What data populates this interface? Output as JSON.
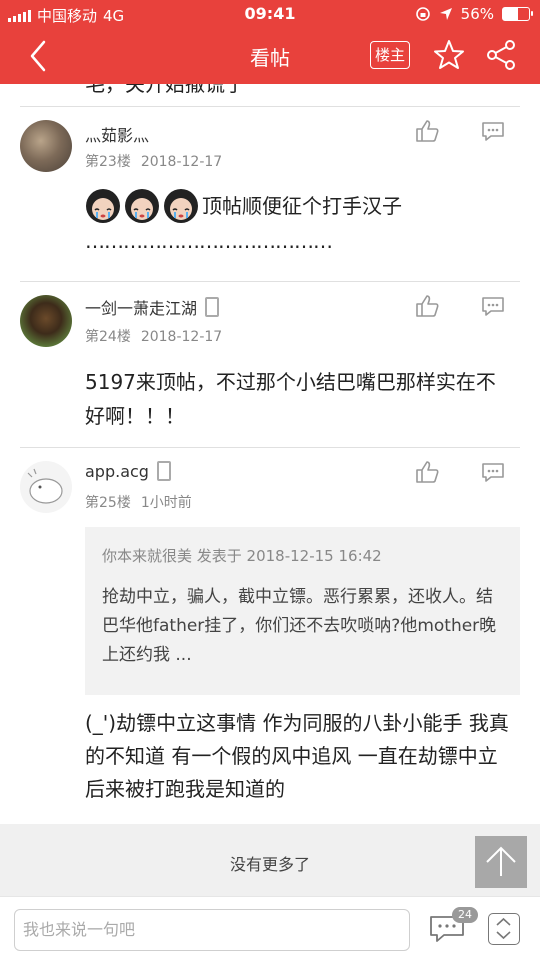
{
  "statusbar": {
    "carrier": "中国移动",
    "network": "4G",
    "time": "09:41",
    "battery": "56%"
  },
  "nav": {
    "title": "看帖",
    "louzhu": "楼主"
  },
  "feed": {
    "cut_text": "毛，关开始撒谎了",
    "posts": [
      {
        "user": "灬茹影灬",
        "floor": "第23楼",
        "time": "2018-12-17",
        "content_line1": "顶帖顺便征个打手汉子",
        "content_line2": "…………………………………"
      },
      {
        "user": "一剑一萧走江湖",
        "floor": "第24楼",
        "time": "2018-12-17",
        "content": "5197来顶帖，不过那个小结巴嘴巴那样实在不好啊！！！"
      },
      {
        "user": "app.acg",
        "floor": "第25楼",
        "time": "1小时前",
        "quote_head": "你本来就很美 发表于 2018-12-15 16:42",
        "quote_text": "抢劫中立，骗人，截中立镖。恶行累累，还收人。结巴华他father挂了，你们还不去吹唢呐?他mother晚上还约我 ...",
        "content": "(_')劫镖中立这事情 作为同服的八卦小能手 我真的不知道 有一个假的风中追风 一直在劫镖中立后来被打跑我是知道的"
      }
    ]
  },
  "footer": {
    "more": "没有更多了",
    "input_placeholder": "我也来说一句吧",
    "comment_count": "24"
  },
  "colors": {
    "brand": "#e8413c"
  }
}
